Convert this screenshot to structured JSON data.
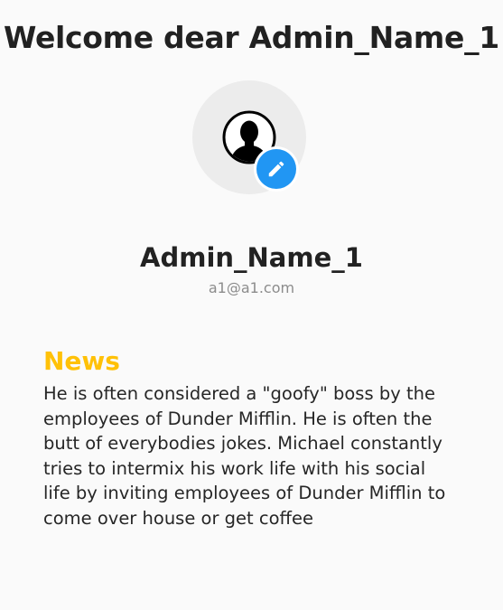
{
  "header": {
    "welcome_text": "Welcome dear Admin_Name_1"
  },
  "profile": {
    "avatar_icon": "account-circle-icon",
    "edit_icon": "pencil-icon",
    "name": "Admin_Name_1",
    "email": "a1@a1.com"
  },
  "news": {
    "title": "News",
    "body": "He is often considered a \"goofy\" boss by the employees of Dunder Mifflin. He is often the butt of everybodies jokes. Michael constantly tries to intermix his work life with his social life by inviting employees of Dunder Mifflin to come over house or get coffee"
  },
  "colors": {
    "background": "#fafafa",
    "avatar_bg": "#ececec",
    "edit_button": "#2196f3",
    "news_title": "#ffc107",
    "email_text": "#8c8c8c"
  }
}
